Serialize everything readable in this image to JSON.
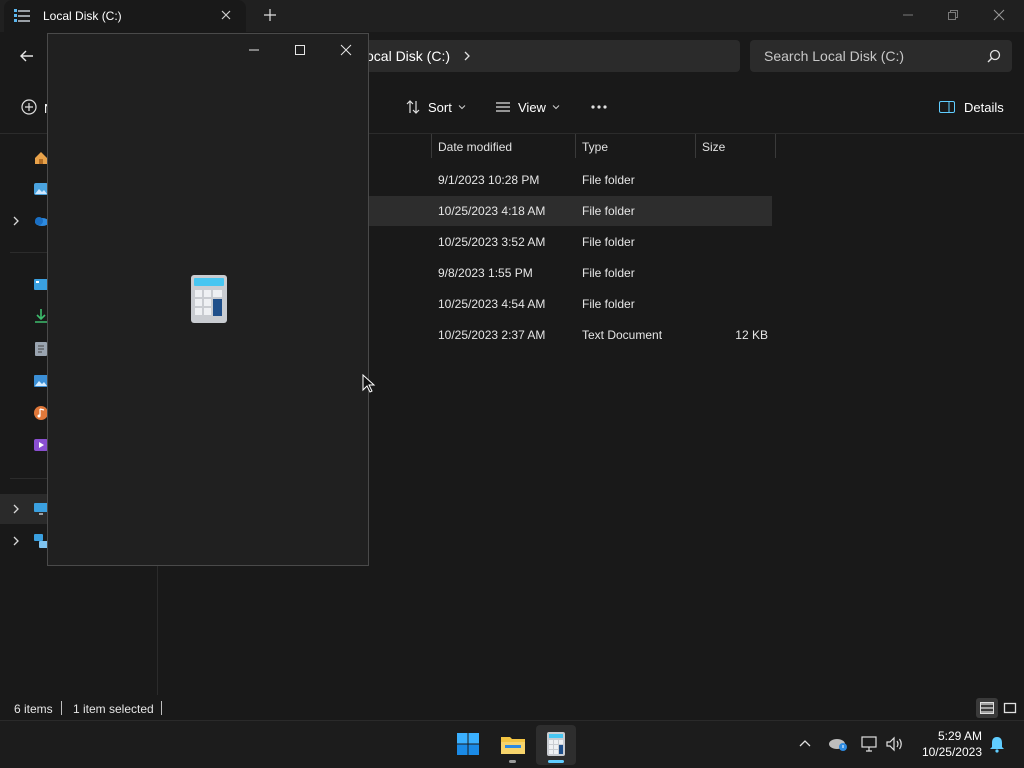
{
  "explorer": {
    "tab_title": "Local Disk (C:)",
    "address_text": "ocal Disk (C:)",
    "search_placeholder": "Search Local Disk (C:)",
    "new_label": "N",
    "sort_label": "Sort",
    "view_label": "View",
    "details_label": "Details",
    "columns": [
      "Date modified",
      "Type",
      "Size"
    ],
    "rows": [
      {
        "date": "9/1/2023 10:28 PM",
        "type": "File folder",
        "size": ""
      },
      {
        "date": "10/25/2023 4:18 AM",
        "type": "File folder",
        "size": ""
      },
      {
        "date": "10/25/2023 3:52 AM",
        "type": "File folder",
        "size": ""
      },
      {
        "date": "9/8/2023 1:55 PM",
        "type": "File folder",
        "size": ""
      },
      {
        "date": "10/25/2023 4:54 AM",
        "type": "File folder",
        "size": ""
      },
      {
        "date": "10/25/2023 2:37 AM",
        "type": "Text Document",
        "size": "12 KB"
      }
    ],
    "status_items": "6 items",
    "status_selected": "1 item selected"
  },
  "taskbar": {
    "time": "5:29 AM",
    "date": "10/25/2023"
  },
  "colors": {
    "accent": "#60cdff",
    "background": "#191919",
    "selection": "#2d2d2d",
    "folder_yellow": "#f4c542",
    "windows_blue": "#0078d4"
  }
}
